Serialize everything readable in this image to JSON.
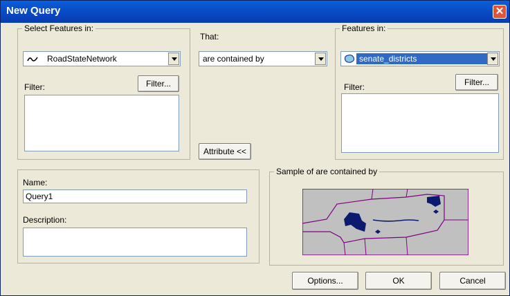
{
  "window": {
    "title": "New Query",
    "close_glyph": "✕"
  },
  "select_features": {
    "group_label": "Select Features in:",
    "layer": "RoadStateNetwork",
    "filter_label": "Filter:",
    "filter_button": "Filter..."
  },
  "that": {
    "label": "That:",
    "relation": "are contained by",
    "attribute_button": "Attribute <<"
  },
  "features_in": {
    "group_label": "Features in:",
    "layer": "senate_districts",
    "filter_label": "Filter:",
    "filter_button": "Filter..."
  },
  "name_section": {
    "name_label": "Name:",
    "name_value": "Query1",
    "description_label": "Description:",
    "description_value": ""
  },
  "sample": {
    "group_label": "Sample of are contained by"
  },
  "buttons": {
    "options": "Options...",
    "ok": "OK",
    "cancel": "Cancel"
  },
  "colors": {
    "titlebar": "#0847c2",
    "selection": "#316ac5",
    "map_fill": "#c0c0c0",
    "map_border": "#800080",
    "feature_fill": "#0b1a6e"
  }
}
